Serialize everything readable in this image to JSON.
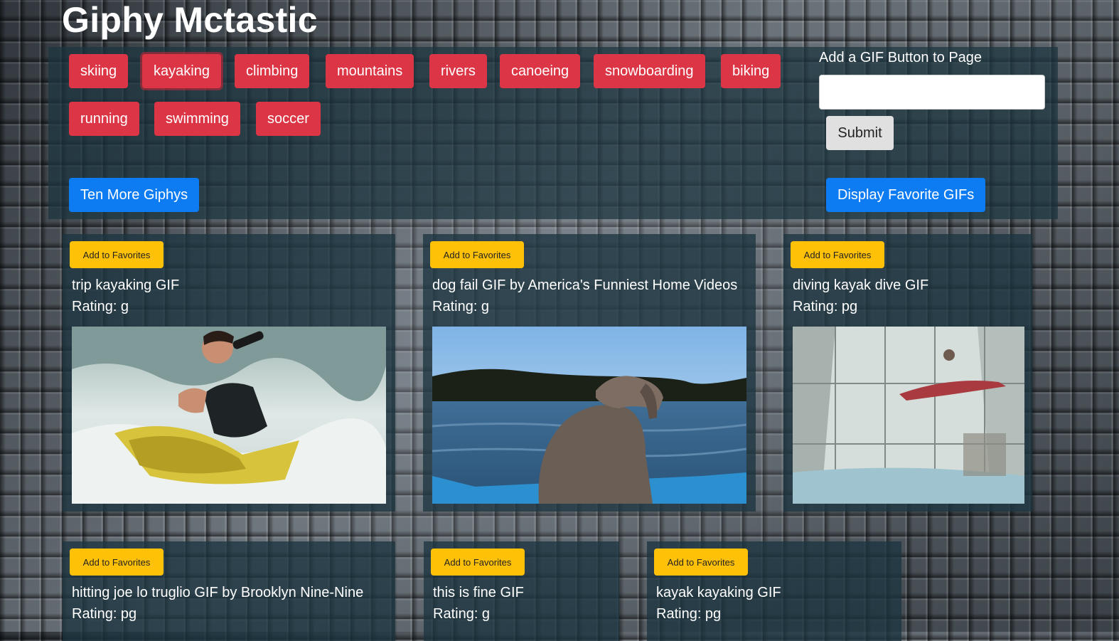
{
  "page": {
    "title": "Giphy Mctastic"
  },
  "topics": [
    "skiing",
    "kayaking",
    "climbing",
    "mountains",
    "rivers",
    "canoeing",
    "snowboarding",
    "biking",
    "running",
    "swimming",
    "soccer"
  ],
  "active_topic": "kayaking",
  "add_form": {
    "label": "Add a GIF Button to Page",
    "input_value": "",
    "submit_label": "Submit"
  },
  "actions": {
    "more_label": "Ten More Giphys",
    "favorites_label": "Display Favorite GIFs"
  },
  "colors": {
    "topic_button": "#dc3545",
    "primary_button": "#0d7cf2",
    "favorite_button": "#ffc107",
    "panel": "#1c3440"
  },
  "gifs": [
    {
      "fav_label": "Add to Favorites",
      "title": "trip kayaking GIF",
      "rating": "Rating: g",
      "image": "kayaker-with-telescope"
    },
    {
      "fav_label": "Add to Favorites",
      "title": "dog fail GIF by America's Funniest Home Videos",
      "rating": "Rating: g",
      "image": "dog-in-boat-on-lake"
    },
    {
      "fav_label": "Add to Favorites",
      "title": "diving kayak dive GIF",
      "rating": "Rating: pg",
      "image": "kayak-diving-through-window"
    },
    {
      "fav_label": "Add to Favorites",
      "title": "hitting joe lo truglio GIF by Brooklyn Nine-Nine",
      "rating": "Rating: pg",
      "image": ""
    },
    {
      "fav_label": "Add to Favorites",
      "title": "this is fine GIF",
      "rating": "Rating: g",
      "image": ""
    },
    {
      "fav_label": "Add to Favorites",
      "title": "kayak kayaking GIF",
      "rating": "Rating: pg",
      "image": ""
    }
  ]
}
